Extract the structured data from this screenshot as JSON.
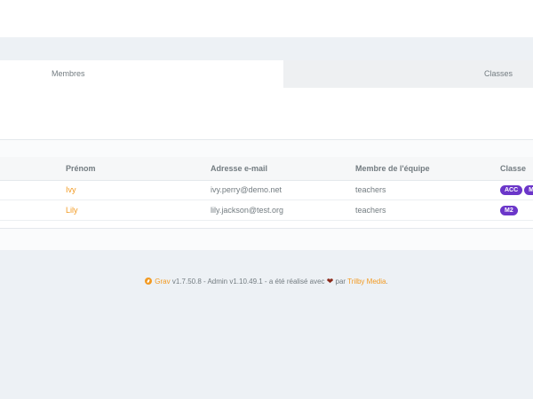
{
  "tabs": [
    {
      "label": "Membres",
      "active": true
    },
    {
      "label": "Classes",
      "active": false
    }
  ],
  "table": {
    "columns": [
      "Prénom",
      "Adresse e-mail",
      "Membre de l'équipe",
      "Classe"
    ],
    "rows": [
      {
        "first_name": "Ivy",
        "email": "ivy.perry@demo.net",
        "team": "teachers",
        "classes": [
          "ACC",
          "M"
        ]
      },
      {
        "first_name": "Lily",
        "email": "lily.jackson@test.org",
        "team": "teachers",
        "classes": [
          "M2"
        ]
      }
    ]
  },
  "footer": {
    "grav_link": "Grav",
    "text1": " v1.7.50.8 - Admin v1.10.49.1 - a été réalisé avec ",
    "text2": " par ",
    "trilby_link": "Trilby Media",
    "end": ".",
    "heart_icon": "heart-icon"
  },
  "colors": {
    "accent": "#f29a22",
    "badge": "#6b36c9",
    "background": "#edf1f5"
  }
}
